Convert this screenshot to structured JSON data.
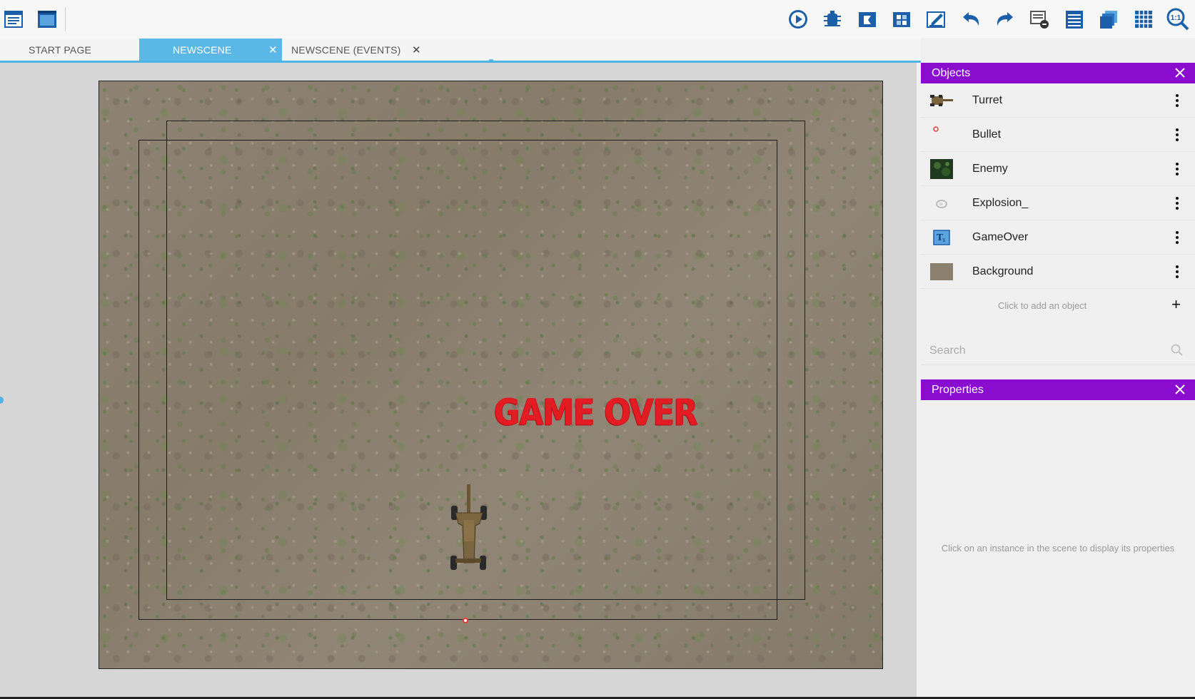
{
  "tabs": [
    {
      "label": "START PAGE",
      "active": false,
      "closable": false
    },
    {
      "label": "NEWSCENE",
      "active": true,
      "closable": true
    },
    {
      "label": "NEWSCENE (EVENTS)",
      "active": false,
      "closable": true
    }
  ],
  "toolbar": {
    "left_icons": [
      "project-manager-icon",
      "start-page-icon"
    ],
    "right_icons": [
      "preview-icon",
      "debug-icon",
      "object-editor-icon",
      "object-groups-icon",
      "edit-scene-properties-icon",
      "undo-icon",
      "redo-icon",
      "instance-list-icon",
      "layers-icon",
      "layers-stack-icon",
      "grid-icon",
      "zoom-icon"
    ],
    "zoom_label": "1:1"
  },
  "scene": {
    "game_over_text": "GAME OVER",
    "game_over_color": "#e31b23",
    "background_color": "#8b7f6e"
  },
  "objects_panel": {
    "title": "Objects",
    "items": [
      {
        "label": "Turret",
        "thumb": "turret-thumb"
      },
      {
        "label": "Bullet",
        "thumb": "bullet-thumb"
      },
      {
        "label": "Enemy",
        "thumb": "enemy-thumb"
      },
      {
        "label": "Explosion_",
        "thumb": "explosion-thumb"
      },
      {
        "label": "GameOver",
        "thumb": "text-object-thumb"
      },
      {
        "label": "Background",
        "thumb": "background-thumb"
      }
    ],
    "add_object_label": "Click to add an object",
    "search_placeholder": "Search"
  },
  "properties_panel": {
    "title": "Properties",
    "empty_message": "Click on an instance in the scene to display its properties"
  },
  "colors": {
    "panel_header": "#8a0ccf",
    "tab_active": "#5bb8e6",
    "accent": "#4fb3e6"
  }
}
